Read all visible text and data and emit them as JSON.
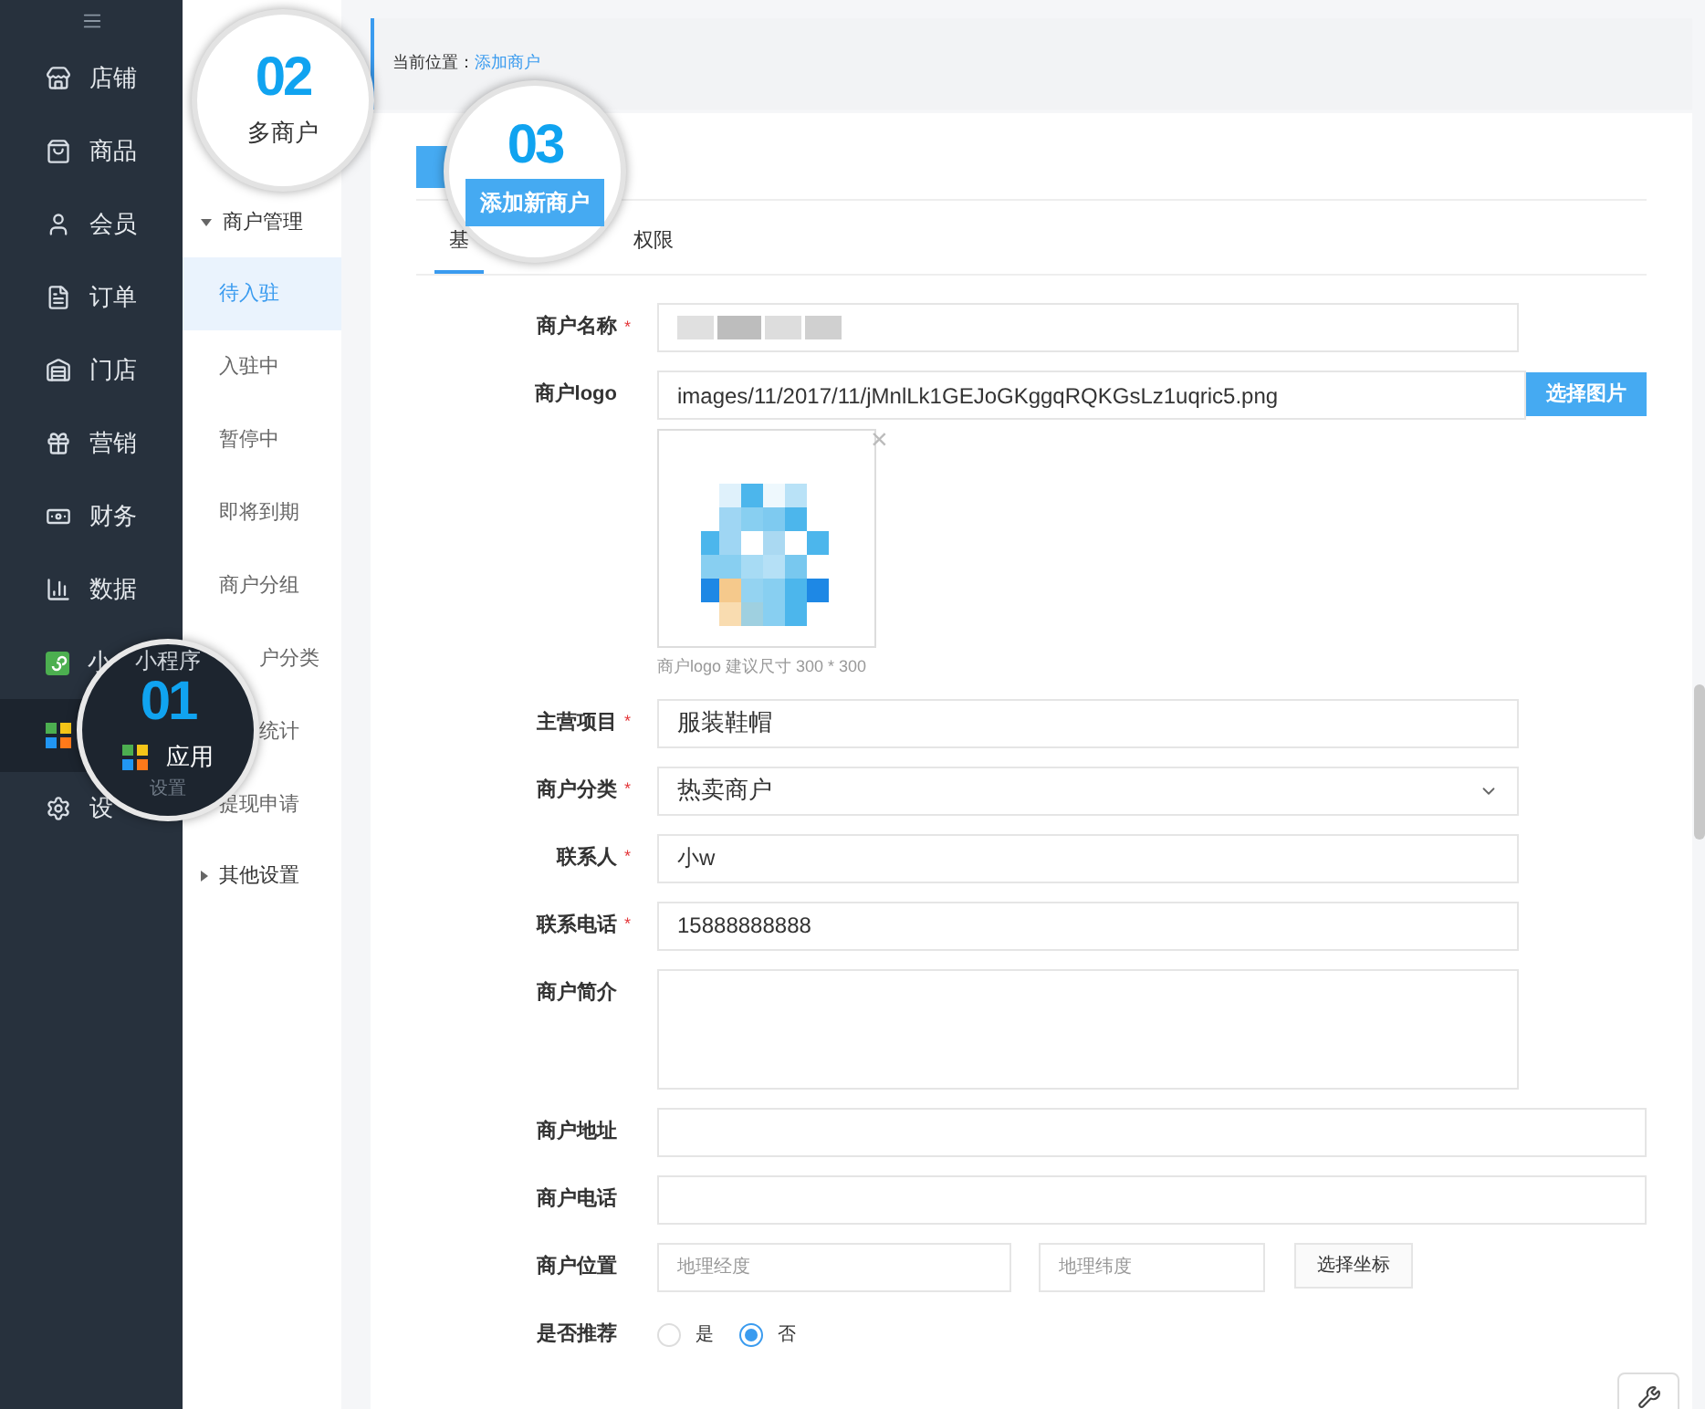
{
  "sidebar": {
    "items": [
      {
        "label": "店铺",
        "selected": false
      },
      {
        "label": "商品",
        "selected": false
      },
      {
        "label": "会员",
        "selected": false
      },
      {
        "label": "订单",
        "selected": false
      },
      {
        "label": "门店",
        "selected": false
      },
      {
        "label": "营销",
        "selected": false
      },
      {
        "label": "财务",
        "selected": false
      },
      {
        "label": "数据",
        "selected": false
      },
      {
        "label": "小",
        "selected": false
      },
      {
        "selected": true
      },
      {
        "label": "设",
        "selected": false
      }
    ]
  },
  "submenu": {
    "groups": [
      {
        "label": "商户管理",
        "expanded": true,
        "children": [
          {
            "label": "待入驻",
            "selected": true
          },
          {
            "label": "入驻中",
            "selected": false
          },
          {
            "label": "暂停中",
            "selected": false
          },
          {
            "label": "即将到期",
            "selected": false
          },
          {
            "label": "商户分组",
            "selected": false
          },
          {
            "label": "户分类",
            "selected": false
          },
          {
            "label": "统计",
            "selected": false
          },
          {
            "label": "提现申请",
            "selected": false
          }
        ]
      },
      {
        "label": "其他设置",
        "expanded": false
      }
    ]
  },
  "breadcrumb": {
    "prefix": "当前位置：",
    "link": "添加商户"
  },
  "tabs": [
    {
      "label": "基",
      "selected": true
    },
    {
      "label": "权限",
      "selected": false
    }
  ],
  "form": {
    "required_mark": "*",
    "fields": [
      {
        "kind": "masked",
        "label": "商户名称",
        "required": true
      },
      {
        "kind": "image",
        "label": "商户logo",
        "value": "images/11/2017/11/jMnlLk1GEJoGKggqRQKGsLz1uqric5.png",
        "button": "选择图片",
        "remove": "×",
        "hint": "商户logo 建议尺寸 300 * 300"
      },
      {
        "kind": "text",
        "label": "主营项目",
        "required": true,
        "value": "服装鞋帽"
      },
      {
        "kind": "select",
        "label": "商户分类",
        "required": true,
        "value": "热卖商户"
      },
      {
        "kind": "text",
        "label": "联系人",
        "required": true,
        "value": "小w"
      },
      {
        "kind": "text",
        "label": "联系电话",
        "required": true,
        "value": "15888888888"
      },
      {
        "kind": "textarea",
        "label": "商户简介",
        "required": false
      },
      {
        "kind": "wide",
        "label": "商户地址",
        "required": false
      },
      {
        "kind": "wide",
        "label": "商户电话",
        "required": false
      },
      {
        "kind": "location",
        "label": "商户位置",
        "placeholders": [
          "地理经度",
          "地理纬度"
        ],
        "button": "选择坐标"
      },
      {
        "kind": "radio",
        "label": "是否推荐",
        "options": [
          {
            "label": "是",
            "selected": false
          },
          {
            "label": "否",
            "selected": true
          }
        ]
      }
    ]
  },
  "callouts": [
    {
      "kind": "light",
      "number": "02",
      "label": "多商户"
    },
    {
      "kind": "button",
      "number": "03",
      "button": "添加新商户"
    },
    {
      "kind": "dark",
      "number": "01",
      "top_text": "小程序",
      "label": "应用",
      "bottom_text": "设置"
    }
  ]
}
